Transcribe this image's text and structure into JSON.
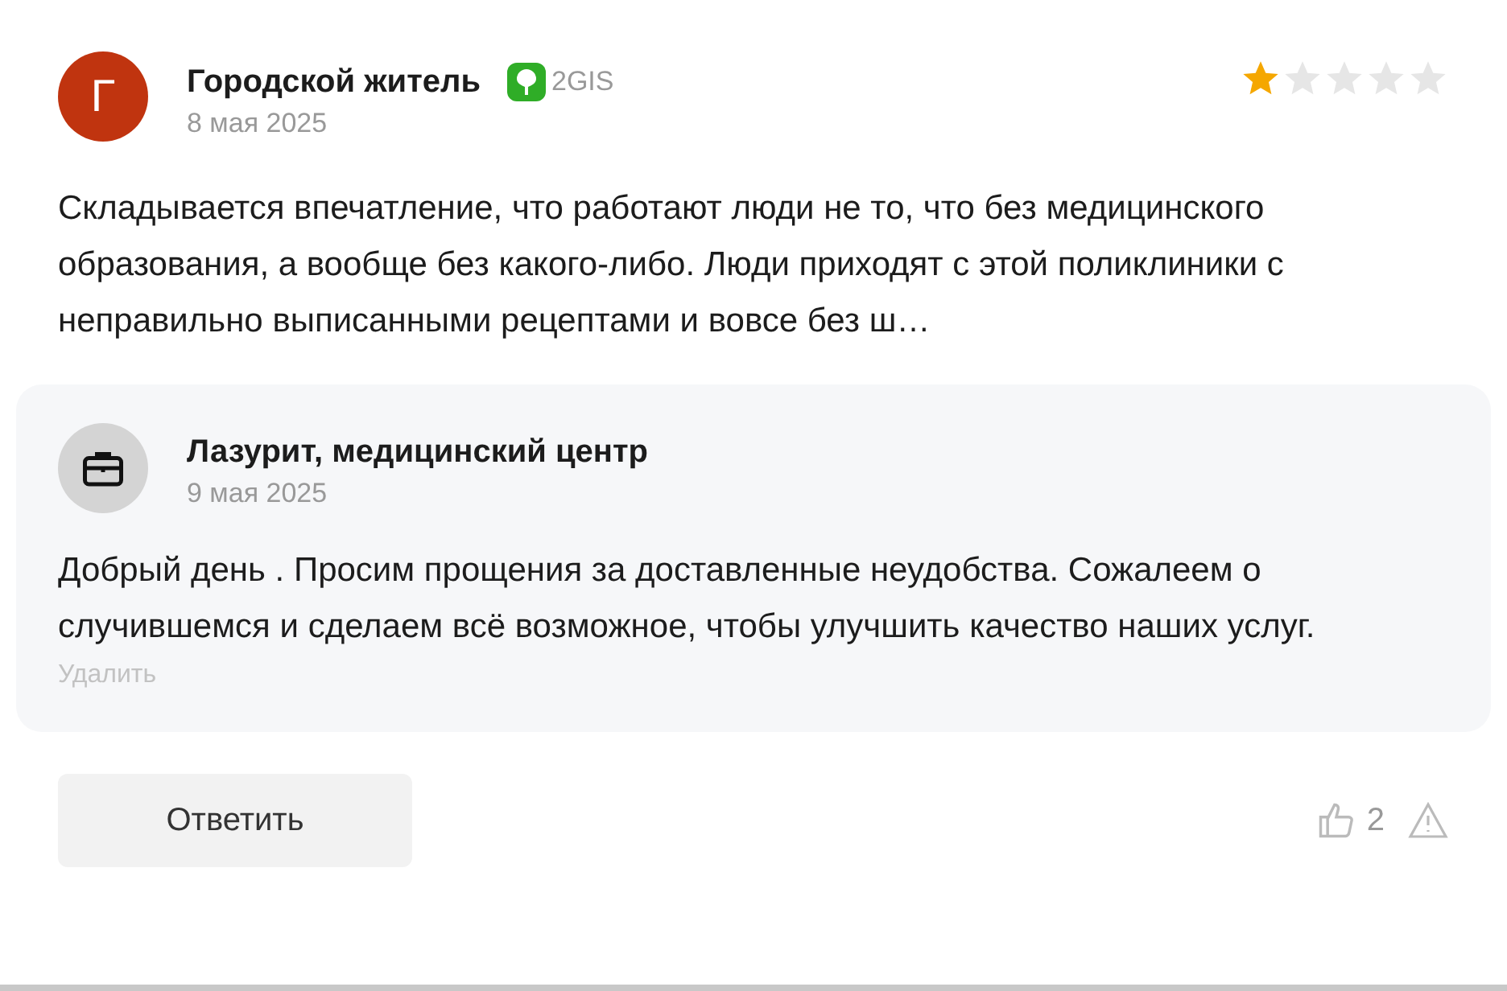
{
  "review": {
    "avatar_letter": "Г",
    "author": "Городской житель",
    "source": "2GIS",
    "date": "8 мая 2025",
    "stars": 1,
    "text": "Складывается впечатление, что работают люди не то, что без медицинского образования, а вообще без какого-либо. Люди приходят с этой поликлиники с неправильно выписанными рецептами и вовсе без ш…"
  },
  "reply": {
    "author": "Лазурит, медицинский центр",
    "date": "9 мая 2025",
    "text": "Добрый день . Просим прощения за доставленные неудобства. Сожалеем о случившемся и сделаем всё возможное, чтобы улучшить качество наших услуг.",
    "delete_label": "Удалить"
  },
  "actions": {
    "reply_button": "Ответить",
    "likes": "2"
  }
}
